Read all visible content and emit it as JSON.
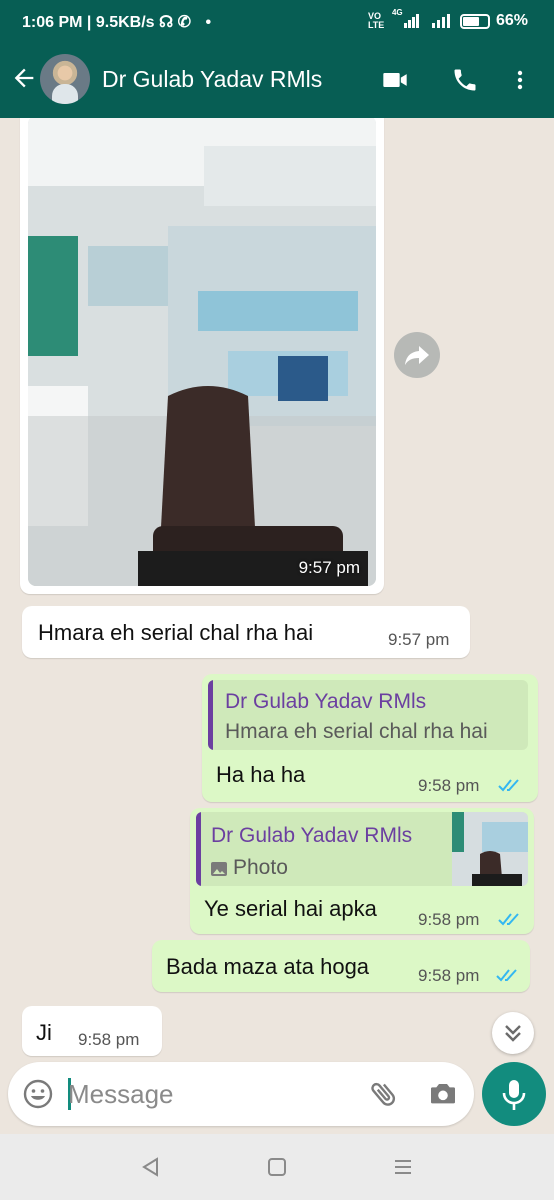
{
  "status_bar": {
    "time": "1:06 PM",
    "net_speed": "9.5KB/s",
    "volte": "VO LTE",
    "network": "4G",
    "battery": "66%"
  },
  "header": {
    "contact_name": "Dr Gulab Yadav RMls",
    "icons": [
      "back-arrow-icon",
      "video-call-icon",
      "phone-icon",
      "more-options-icon"
    ],
    "color": "#075e54"
  },
  "messages": {
    "m1_photo": {
      "time": "9:57 pm"
    },
    "m2": {
      "text": "Hmara eh serial  chal rha hai",
      "time": "9:57 pm"
    },
    "m3": {
      "quote_name": "Dr Gulab Yadav RMls",
      "quote_text": "Hmara eh serial  chal rha hai",
      "text": "Ha ha ha",
      "time": "9:58 pm"
    },
    "m4": {
      "quote_name": "Dr Gulab Yadav RMls",
      "quote_text": "Photo",
      "text": "Ye serial hai apka",
      "time": "9:58 pm"
    },
    "m5": {
      "text": "Bada maza ata hoga",
      "time": "9:58 pm"
    },
    "m6": {
      "text": "Ji",
      "time": "9:58 pm"
    }
  },
  "input": {
    "placeholder": "Message"
  },
  "colors": {
    "incoming": "#ffffff",
    "outgoing": "#dcf8c6",
    "accent": "#128c7e",
    "read_ticks": "#34b7f1",
    "quote_name": "#6b3fa0"
  }
}
